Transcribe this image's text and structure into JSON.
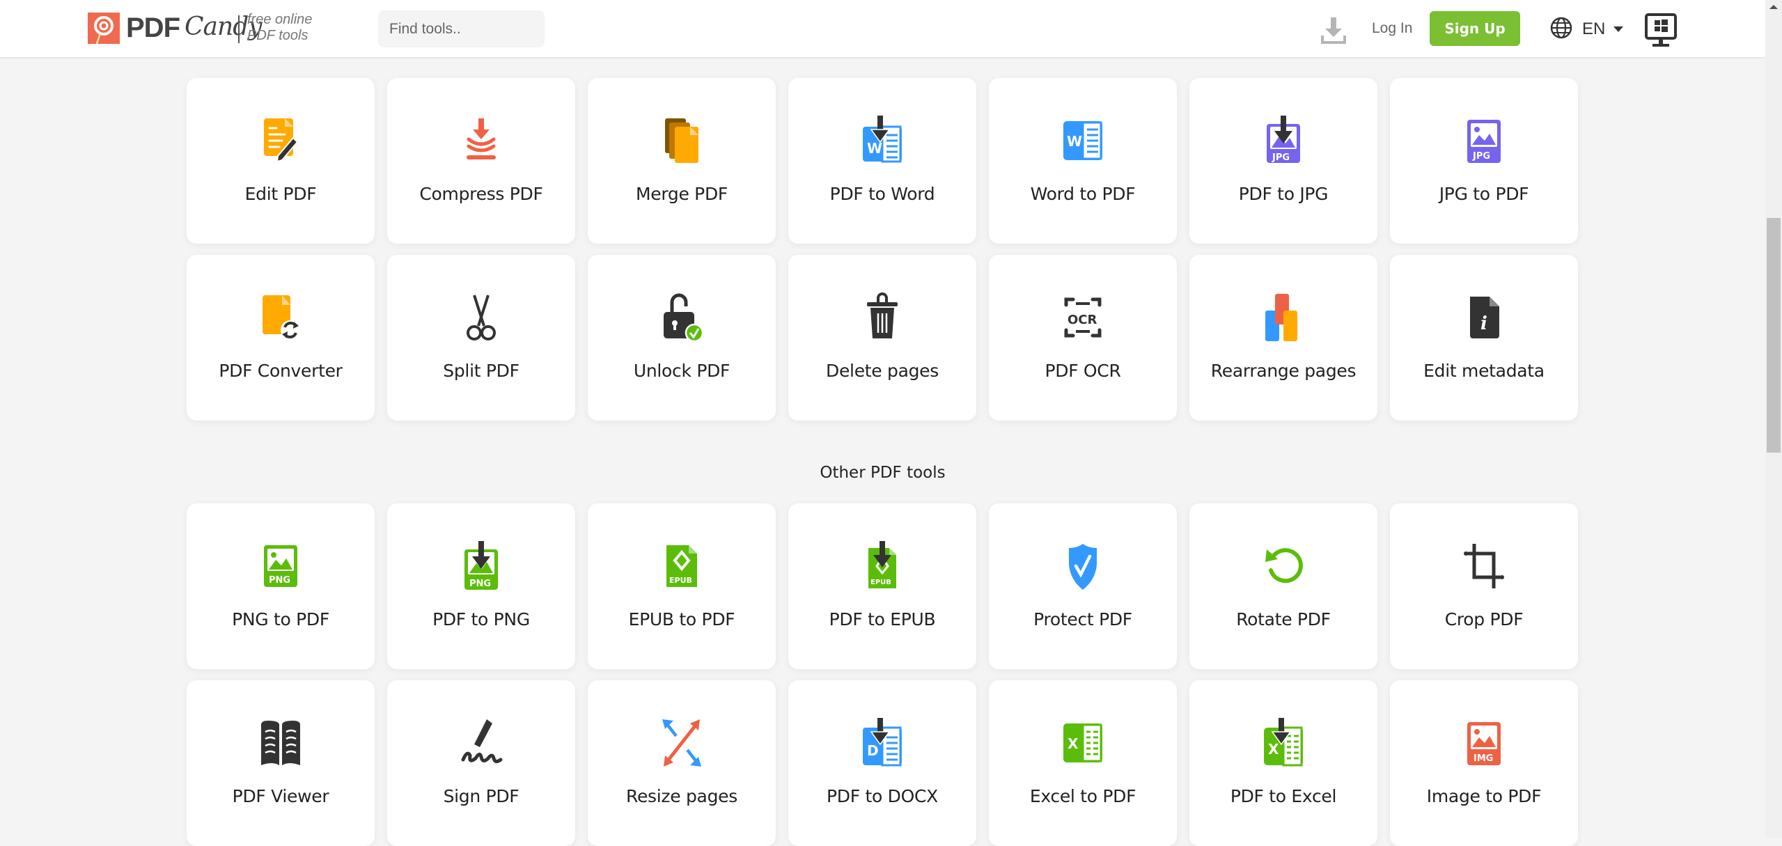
{
  "header": {
    "logo_primary": "PDF",
    "logo_secondary": "Candy",
    "tagline_line1": "free online",
    "tagline_line2": "PDF tools",
    "search_placeholder": "Find tools..",
    "download_icon": "download-icon",
    "login_label": "Log In",
    "signup_label": "Sign Up",
    "language_code": "EN",
    "language_icon": "globe-icon",
    "desktop_app_icon": "windows-monitor-icon"
  },
  "colors": {
    "accent_green": "#7bbf33",
    "logo_red": "#ef6a4f",
    "background": "#f4f4f5"
  },
  "popular_tools": [
    {
      "label": "Edit PDF",
      "icon": "edit-pdf-icon"
    },
    {
      "label": "Compress PDF",
      "icon": "compress-icon"
    },
    {
      "label": "Merge PDF",
      "icon": "merge-icon"
    },
    {
      "label": "PDF to Word",
      "icon": "pdf-to-word-icon"
    },
    {
      "label": "Word to PDF",
      "icon": "word-icon"
    },
    {
      "label": "PDF to JPG",
      "icon": "pdf-to-jpg-icon"
    },
    {
      "label": "JPG to PDF",
      "icon": "jpg-icon"
    },
    {
      "label": "PDF Converter",
      "icon": "converter-icon"
    },
    {
      "label": "Split PDF",
      "icon": "scissors-icon"
    },
    {
      "label": "Unlock PDF",
      "icon": "unlock-icon"
    },
    {
      "label": "Delete pages",
      "icon": "trash-icon"
    },
    {
      "label": "PDF OCR",
      "icon": "ocr-icon"
    },
    {
      "label": "Rearrange pages",
      "icon": "rearrange-icon"
    },
    {
      "label": "Edit metadata",
      "icon": "metadata-icon"
    }
  ],
  "other_section_title": "Other PDF tools",
  "other_tools": [
    {
      "label": "PNG to PDF",
      "icon": "png-icon"
    },
    {
      "label": "PDF to PNG",
      "icon": "pdf-to-png-icon"
    },
    {
      "label": "EPUB to PDF",
      "icon": "epub-icon"
    },
    {
      "label": "PDF to EPUB",
      "icon": "pdf-to-epub-icon"
    },
    {
      "label": "Protect PDF",
      "icon": "shield-icon"
    },
    {
      "label": "Rotate PDF",
      "icon": "rotate-icon"
    },
    {
      "label": "Crop PDF",
      "icon": "crop-icon"
    },
    {
      "label": "PDF Viewer",
      "icon": "book-icon"
    },
    {
      "label": "Sign PDF",
      "icon": "signature-icon"
    },
    {
      "label": "Resize pages",
      "icon": "resize-icon"
    },
    {
      "label": "PDF to DOCX",
      "icon": "pdf-to-docx-icon"
    },
    {
      "label": "Excel to PDF",
      "icon": "excel-icon"
    },
    {
      "label": "PDF to Excel",
      "icon": "pdf-to-excel-icon"
    },
    {
      "label": "Image to PDF",
      "icon": "image-icon"
    }
  ]
}
